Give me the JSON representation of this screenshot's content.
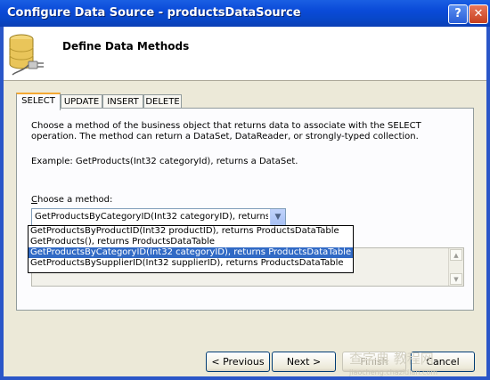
{
  "window": {
    "title": "Configure Data Source - productsDataSource",
    "help_glyph": "?",
    "close_glyph": "✕"
  },
  "header": {
    "title": "Define Data Methods",
    "icon": "database-plug-icon"
  },
  "tabs": [
    {
      "label": "SELECT",
      "active": true
    },
    {
      "label": "UPDATE",
      "active": false
    },
    {
      "label": "INSERT",
      "active": false
    },
    {
      "label": "DELETE",
      "active": false
    }
  ],
  "select_panel": {
    "description": "Choose a method of the business object that returns data to associate with the SELECT operation. The method can return a DataSet, DataReader, or strongly-typed collection.",
    "example": "Example: GetProducts(Int32 categoryId), returns a DataSet.",
    "choose_label": "Choose a method:",
    "choose_accesskey": "C",
    "method_combo": {
      "value": "GetProductsByCategoryID(Int32 categoryID), returns ProductsDataTable"
    },
    "method_options": [
      "GetProductsByProductID(Int32 productID), returns ProductsDataTable",
      "GetProducts(), returns ProductsDataTable",
      "GetProductsByCategoryID(Int32 categoryID), returns ProductsDataTable",
      "GetProductsBySupplierID(Int32 supplierID), returns ProductsDataTable"
    ],
    "selected_option_index": 2
  },
  "buttons": {
    "previous": "< Previous",
    "next": "Next >",
    "finish": "Finish",
    "cancel": "Cancel"
  },
  "watermark": {
    "text": "查字典 教程网",
    "url": "jiaocheng.chazidian.com"
  },
  "colors": {
    "titlebar": "#0a4ad8",
    "selection": "#316ac5",
    "active_tab_accent": "#f4a832",
    "dialog_face": "#ece9d8"
  }
}
